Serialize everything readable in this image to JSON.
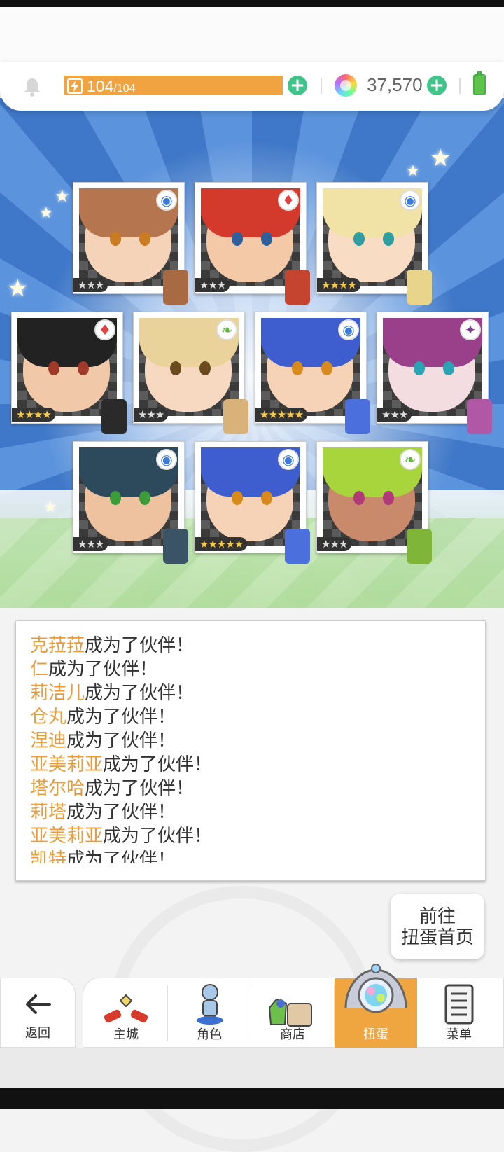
{
  "status": {
    "energy_current": "104",
    "energy_max": "/104",
    "gems": "37,570"
  },
  "cards": [
    {
      "id": "c1",
      "stars": "★★★",
      "attribute": "blue"
    },
    {
      "id": "c2",
      "stars": "★★★",
      "attribute": "red"
    },
    {
      "id": "c3",
      "stars": "★★★★",
      "attribute": "blue"
    },
    {
      "id": "c4",
      "stars": "★★★★",
      "attribute": "red"
    },
    {
      "id": "c5",
      "stars": "★★★",
      "attribute": "green"
    },
    {
      "id": "c6",
      "stars": "★★★★★",
      "attribute": "blue"
    },
    {
      "id": "c7",
      "stars": "★★★",
      "attribute": "purple"
    },
    {
      "id": "c8",
      "stars": "★★★",
      "attribute": "blue"
    },
    {
      "id": "c9",
      "stars": "★★★★★",
      "attribute": "blue"
    },
    {
      "id": "c10",
      "stars": "★★★",
      "attribute": "green"
    }
  ],
  "log": {
    "suffix": "成为了伙伴！",
    "names": [
      "克菈菈",
      "仁",
      "莉洁儿",
      "仓丸",
      "涅迪",
      "亚美莉亚",
      "塔尔哈",
      "莉塔",
      "亚美莉亚",
      "凯特"
    ]
  },
  "goto_button": {
    "line1": "前往",
    "line2": "扭蛋首页"
  },
  "nav": {
    "back": "返回",
    "tabs": [
      "主城",
      "角色",
      "商店",
      "扭蛋",
      "菜单"
    ],
    "active": "扭蛋"
  },
  "colors": {
    "accent": "#f0a640",
    "name_highlight": "#eb9c3a",
    "plus": "#3fc48a"
  }
}
